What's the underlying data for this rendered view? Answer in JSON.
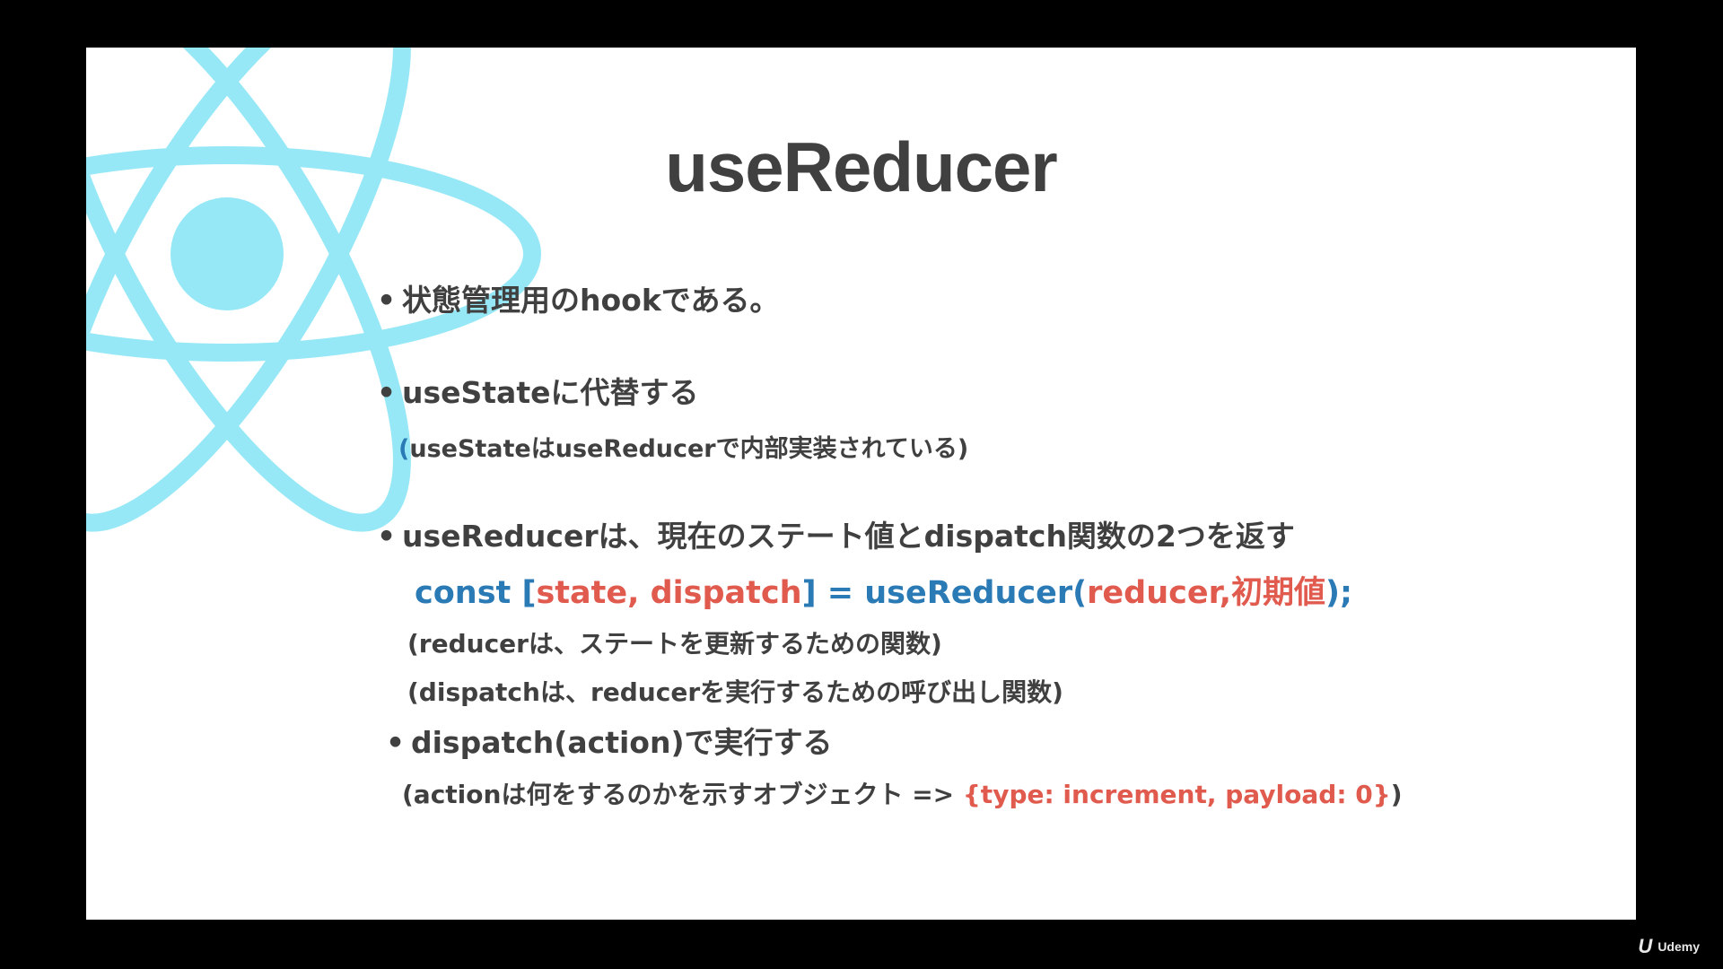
{
  "slide": {
    "title": "useReducer",
    "bullet_char": "•",
    "bullets": [
      {
        "text": "状態管理用のhookである。"
      },
      {
        "text": "useStateに代替する",
        "sub": {
          "open": "(",
          "body": "useStateはuseReducerで内部実装されている)"
        }
      },
      {
        "text": "useReducerは、現在のステート値とdispatch関数の2つを返す"
      },
      {
        "text": "dispatch(action)で実行する"
      }
    ],
    "code": {
      "part1": "const [",
      "part2": "state, dispatch",
      "part3": "] = useReducer(",
      "part4": "reducer,初期値",
      "part5": ");"
    },
    "notes": [
      "(reducerは、ステートを更新するための関数)",
      "(dispatchは、reducerを実行するための呼び出し関数)"
    ],
    "action_note": {
      "prefix": "(actionは何をするのかを示すオブジェクト => ",
      "object": "{type: increment, payload: 0}",
      "suffix": ")"
    }
  },
  "watermark": {
    "mark": "U",
    "label": "Udemy"
  },
  "colors": {
    "accent_blue": "#2a7ab5",
    "accent_red": "#e05a4e",
    "react_logo": "#97e8f7",
    "text": "#404040"
  },
  "icons": {
    "logo": "react-atom-logo"
  }
}
